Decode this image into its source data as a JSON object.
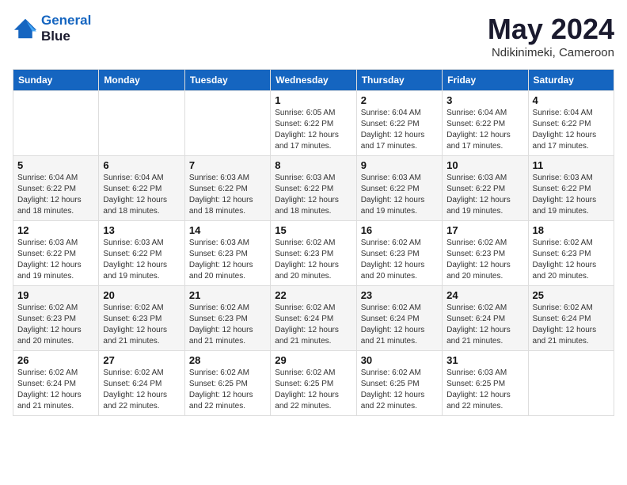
{
  "logo": {
    "line1": "General",
    "line2": "Blue"
  },
  "title": "May 2024",
  "subtitle": "Ndikinimeki, Cameroon",
  "days_of_week": [
    "Sunday",
    "Monday",
    "Tuesday",
    "Wednesday",
    "Thursday",
    "Friday",
    "Saturday"
  ],
  "weeks": [
    [
      {
        "day": "",
        "info": ""
      },
      {
        "day": "",
        "info": ""
      },
      {
        "day": "",
        "info": ""
      },
      {
        "day": "1",
        "info": "Sunrise: 6:05 AM\nSunset: 6:22 PM\nDaylight: 12 hours\nand 17 minutes."
      },
      {
        "day": "2",
        "info": "Sunrise: 6:04 AM\nSunset: 6:22 PM\nDaylight: 12 hours\nand 17 minutes."
      },
      {
        "day": "3",
        "info": "Sunrise: 6:04 AM\nSunset: 6:22 PM\nDaylight: 12 hours\nand 17 minutes."
      },
      {
        "day": "4",
        "info": "Sunrise: 6:04 AM\nSunset: 6:22 PM\nDaylight: 12 hours\nand 17 minutes."
      }
    ],
    [
      {
        "day": "5",
        "info": "Sunrise: 6:04 AM\nSunset: 6:22 PM\nDaylight: 12 hours\nand 18 minutes."
      },
      {
        "day": "6",
        "info": "Sunrise: 6:04 AM\nSunset: 6:22 PM\nDaylight: 12 hours\nand 18 minutes."
      },
      {
        "day": "7",
        "info": "Sunrise: 6:03 AM\nSunset: 6:22 PM\nDaylight: 12 hours\nand 18 minutes."
      },
      {
        "day": "8",
        "info": "Sunrise: 6:03 AM\nSunset: 6:22 PM\nDaylight: 12 hours\nand 18 minutes."
      },
      {
        "day": "9",
        "info": "Sunrise: 6:03 AM\nSunset: 6:22 PM\nDaylight: 12 hours\nand 19 minutes."
      },
      {
        "day": "10",
        "info": "Sunrise: 6:03 AM\nSunset: 6:22 PM\nDaylight: 12 hours\nand 19 minutes."
      },
      {
        "day": "11",
        "info": "Sunrise: 6:03 AM\nSunset: 6:22 PM\nDaylight: 12 hours\nand 19 minutes."
      }
    ],
    [
      {
        "day": "12",
        "info": "Sunrise: 6:03 AM\nSunset: 6:22 PM\nDaylight: 12 hours\nand 19 minutes."
      },
      {
        "day": "13",
        "info": "Sunrise: 6:03 AM\nSunset: 6:22 PM\nDaylight: 12 hours\nand 19 minutes."
      },
      {
        "day": "14",
        "info": "Sunrise: 6:03 AM\nSunset: 6:23 PM\nDaylight: 12 hours\nand 20 minutes."
      },
      {
        "day": "15",
        "info": "Sunrise: 6:02 AM\nSunset: 6:23 PM\nDaylight: 12 hours\nand 20 minutes."
      },
      {
        "day": "16",
        "info": "Sunrise: 6:02 AM\nSunset: 6:23 PM\nDaylight: 12 hours\nand 20 minutes."
      },
      {
        "day": "17",
        "info": "Sunrise: 6:02 AM\nSunset: 6:23 PM\nDaylight: 12 hours\nand 20 minutes."
      },
      {
        "day": "18",
        "info": "Sunrise: 6:02 AM\nSunset: 6:23 PM\nDaylight: 12 hours\nand 20 minutes."
      }
    ],
    [
      {
        "day": "19",
        "info": "Sunrise: 6:02 AM\nSunset: 6:23 PM\nDaylight: 12 hours\nand 20 minutes."
      },
      {
        "day": "20",
        "info": "Sunrise: 6:02 AM\nSunset: 6:23 PM\nDaylight: 12 hours\nand 21 minutes."
      },
      {
        "day": "21",
        "info": "Sunrise: 6:02 AM\nSunset: 6:23 PM\nDaylight: 12 hours\nand 21 minutes."
      },
      {
        "day": "22",
        "info": "Sunrise: 6:02 AM\nSunset: 6:24 PM\nDaylight: 12 hours\nand 21 minutes."
      },
      {
        "day": "23",
        "info": "Sunrise: 6:02 AM\nSunset: 6:24 PM\nDaylight: 12 hours\nand 21 minutes."
      },
      {
        "day": "24",
        "info": "Sunrise: 6:02 AM\nSunset: 6:24 PM\nDaylight: 12 hours\nand 21 minutes."
      },
      {
        "day": "25",
        "info": "Sunrise: 6:02 AM\nSunset: 6:24 PM\nDaylight: 12 hours\nand 21 minutes."
      }
    ],
    [
      {
        "day": "26",
        "info": "Sunrise: 6:02 AM\nSunset: 6:24 PM\nDaylight: 12 hours\nand 21 minutes."
      },
      {
        "day": "27",
        "info": "Sunrise: 6:02 AM\nSunset: 6:24 PM\nDaylight: 12 hours\nand 22 minutes."
      },
      {
        "day": "28",
        "info": "Sunrise: 6:02 AM\nSunset: 6:25 PM\nDaylight: 12 hours\nand 22 minutes."
      },
      {
        "day": "29",
        "info": "Sunrise: 6:02 AM\nSunset: 6:25 PM\nDaylight: 12 hours\nand 22 minutes."
      },
      {
        "day": "30",
        "info": "Sunrise: 6:02 AM\nSunset: 6:25 PM\nDaylight: 12 hours\nand 22 minutes."
      },
      {
        "day": "31",
        "info": "Sunrise: 6:03 AM\nSunset: 6:25 PM\nDaylight: 12 hours\nand 22 minutes."
      },
      {
        "day": "",
        "info": ""
      }
    ]
  ]
}
